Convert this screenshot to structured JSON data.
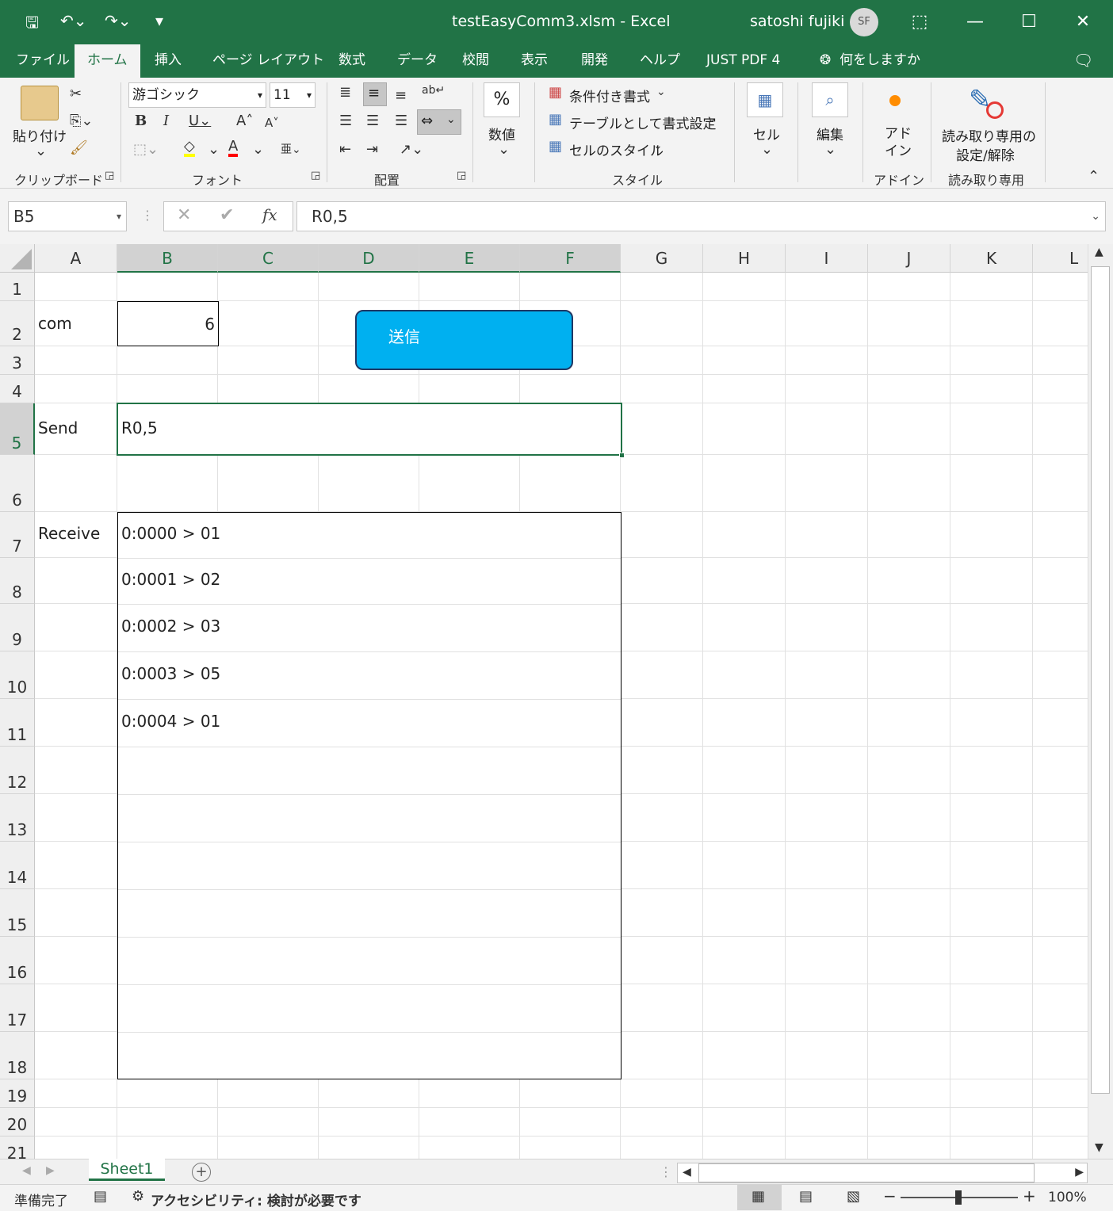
{
  "window": {
    "title": "testEasyComm3.xlsm  -  Excel",
    "user_name": "satoshi fujiki",
    "user_initials": "SF",
    "accent": "#217346"
  },
  "tabs": [
    {
      "label": "ファイル"
    },
    {
      "label": "ホーム"
    },
    {
      "label": "挿入"
    },
    {
      "label": "ページ レイアウト"
    },
    {
      "label": "数式"
    },
    {
      "label": "データ"
    },
    {
      "label": "校閲"
    },
    {
      "label": "表示"
    },
    {
      "label": "開発"
    },
    {
      "label": "ヘルプ"
    },
    {
      "label": "JUST PDF 4"
    }
  ],
  "tell_me": "何をしますか",
  "ribbon": {
    "paste_label": "貼り付け",
    "clipboard_label": "クリップボード",
    "font_name": "游ゴシック",
    "font_size": "11",
    "font_label": "フォント",
    "alignment_label": "配置",
    "number_label": "数値",
    "conditional_format": "条件付き書式",
    "format_as_table": "テーブルとして書式設定",
    "cell_styles": "セルのスタイル",
    "style_label": "スタイル",
    "cells_label": "セル",
    "edit_label": "編集",
    "addin_button": "アド\nイン",
    "addin_label": "アドイン",
    "readonly_button_1": "読み取り専用の",
    "readonly_button_2": "設定/解除",
    "readonly_label": "読み取り専用"
  },
  "formula_bar": {
    "name_box": "B5",
    "formula": "R0,5"
  },
  "columns": [
    "A",
    "B",
    "C",
    "D",
    "E",
    "F",
    "G",
    "H",
    "I",
    "J",
    "K",
    "L"
  ],
  "rows": [
    "1",
    "2",
    "3",
    "4",
    "5",
    "6",
    "7",
    "8",
    "9",
    "10",
    "11",
    "12",
    "13",
    "14",
    "15",
    "16",
    "17",
    "18",
    "19",
    "20",
    "21"
  ],
  "cells": {
    "A2": "com",
    "B2": "6",
    "A5": "Send",
    "B5": "R0,5",
    "A7": "Receive",
    "B7": "0:0000 > 01",
    "B8": "0:0001 > 02",
    "B9": "0:0002 > 03",
    "B10": "0:0003 > 05",
    "B11": "0:0004 > 01"
  },
  "shape_button": {
    "label": "送信",
    "color": "#00b0f0"
  },
  "sheets": [
    {
      "name": "Sheet1"
    }
  ],
  "status": {
    "ready": "準備完了",
    "accessibility": "アクセシビリティ: 検討が必要です",
    "zoom": "100%"
  }
}
